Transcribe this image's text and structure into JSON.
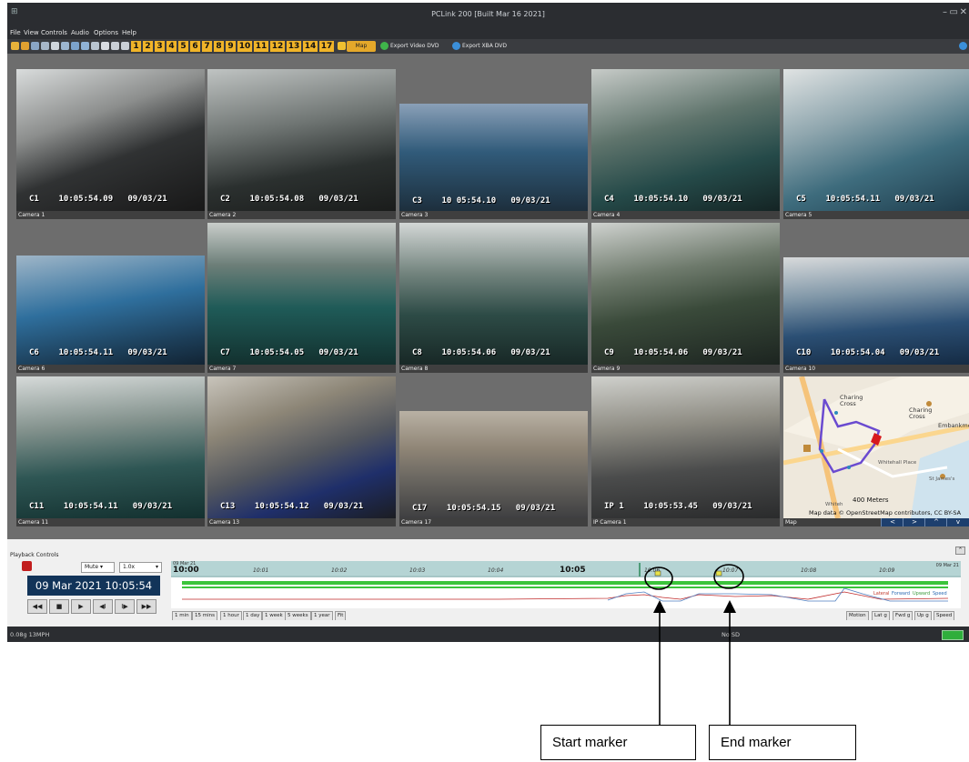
{
  "window": {
    "title": "PCLink 200 [Built Mar 16 2021]"
  },
  "menu": [
    "File",
    "View",
    "Controls",
    "Audio",
    "Options",
    "Help"
  ],
  "toolbar": {
    "camera_buttons": [
      "1",
      "2",
      "3",
      "4",
      "5",
      "6",
      "7",
      "8",
      "9",
      "10",
      "11",
      "12",
      "13",
      "14",
      "17"
    ],
    "map_label": "Map",
    "export_video_dvd": "Export Video DVD",
    "export_xba_dvd": "Export XBA DVD"
  },
  "cameras": [
    {
      "label": "Camera 1",
      "osd": "C1    10:05:54.09   09/03/21"
    },
    {
      "label": "Camera 2",
      "osd": "C2    10:05:54.08   09/03/21"
    },
    {
      "label": "Camera 3",
      "osd": "C3    10 05:54.10   09/03/21"
    },
    {
      "label": "Camera 4",
      "osd": "C4    10:05:54.10   09/03/21"
    },
    {
      "label": "Camera 5",
      "osd": "C5    10:05:54.11   09/03/21"
    },
    {
      "label": "Camera 6",
      "osd": "C6    10:05:54.11   09/03/21"
    },
    {
      "label": "Camera 7",
      "osd": "C7    10:05:54.05   09/03/21"
    },
    {
      "label": "Camera 8",
      "osd": "C8    10:05:54.06   09/03/21"
    },
    {
      "label": "Camera 9",
      "osd": "C9    10:05:54.06   09/03/21"
    },
    {
      "label": "Camera 10",
      "osd": "C10    10:05:54.04   09/03/21"
    },
    {
      "label": "Camera 11",
      "osd": "C11    10:05:54.11   09/03/21"
    },
    {
      "label": "Camera 13",
      "osd": "C13    10:05:54.12   09/03/21"
    },
    {
      "label": "Camera 17",
      "osd": "C17    10:05:54.15   09/03/21"
    },
    {
      "label": "IP Camera 1",
      "osd": "IP 1    10:05:53.45   09/03/21"
    }
  ],
  "map": {
    "label": "Map",
    "places": [
      "Charing Cross",
      "Charing Cross",
      "Embankme",
      "Whitehall Place",
      "St James's",
      "Whiteh"
    ],
    "scale": "400 Meters",
    "attribution": "Map data © OpenStreetMap contributors, CC BY-SA"
  },
  "playback": {
    "title": "Playback Controls",
    "mute": "Mute",
    "speed": "1.0x",
    "datetime": "09 Mar 2021  10:05:54",
    "buttons": [
      "◀◀",
      "■",
      "▶",
      "◀I",
      "I▶",
      "▶▶"
    ]
  },
  "timeline": {
    "left_date": "09 Mar 21",
    "right_date": "09 Mar 21",
    "ticks": [
      "10:00",
      "10:01",
      "10:02",
      "10:03",
      "10:04",
      "10:05",
      "10:06",
      "10:07",
      "10:08",
      "10:09"
    ],
    "legend": [
      "Lateral",
      "Forward",
      "Upward",
      "Speed"
    ],
    "zoom_tabs": [
      "1 min",
      "15 mins",
      "1 hour",
      "1 day",
      "1 week",
      "5 weeks",
      "1 year",
      "Fit"
    ],
    "sensor_tabs": [
      "Motion",
      "Lat g",
      "Fwd g",
      "Up g",
      "Speed"
    ]
  },
  "status": {
    "left": "0.08g   13MPH",
    "center": "No SD"
  },
  "annotations": {
    "start": "Start marker",
    "end": "End marker"
  },
  "colors": {
    "timeline_header": "#b5d4d4",
    "date_display": "#123459",
    "camera_button": "#f0b428",
    "range_bar": "#3bc43b"
  }
}
